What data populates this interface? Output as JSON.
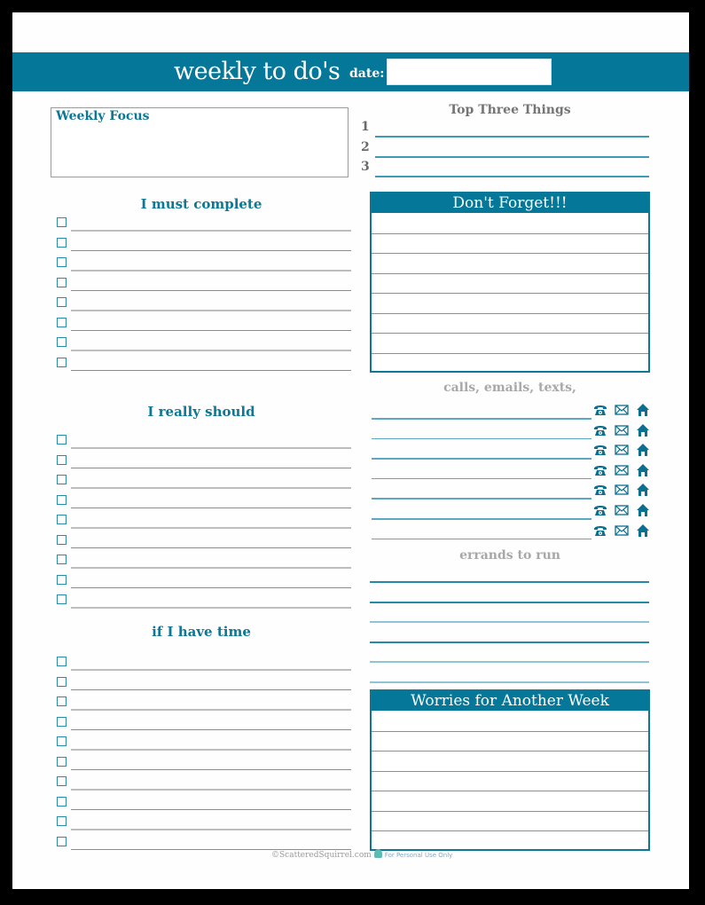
{
  "header": {
    "title": "weekly to do's",
    "date_label": "date:",
    "date_value": ""
  },
  "weekly_focus": {
    "label": "Weekly Focus",
    "value": ""
  },
  "top_three": {
    "title": "Top Three Things",
    "items": [
      {
        "number": "1",
        "value": ""
      },
      {
        "number": "2",
        "value": ""
      },
      {
        "number": "3",
        "value": ""
      }
    ]
  },
  "must_complete": {
    "title": "I must complete",
    "count": 8
  },
  "really_should": {
    "title": "I really should",
    "count": 9
  },
  "if_time": {
    "title": "if I have time",
    "count": 10
  },
  "dont_forget": {
    "title": "Don't Forget!!!",
    "rows": 8
  },
  "calls": {
    "title": "calls, emails, texts,",
    "rows": 7,
    "icons": [
      "phone-icon",
      "envelope-icon",
      "home-icon"
    ]
  },
  "errands": {
    "title": "errands to run",
    "rows": 6
  },
  "worries": {
    "title": "Worries for Another Week",
    "rows": 7
  },
  "footer": {
    "copyright": "©ScatteredSquirrel.com",
    "note": "For Personal Use Only"
  },
  "colors": {
    "accent": "#05789a",
    "heading": "#0d7895",
    "muted_heading": "#a8a8a8"
  }
}
